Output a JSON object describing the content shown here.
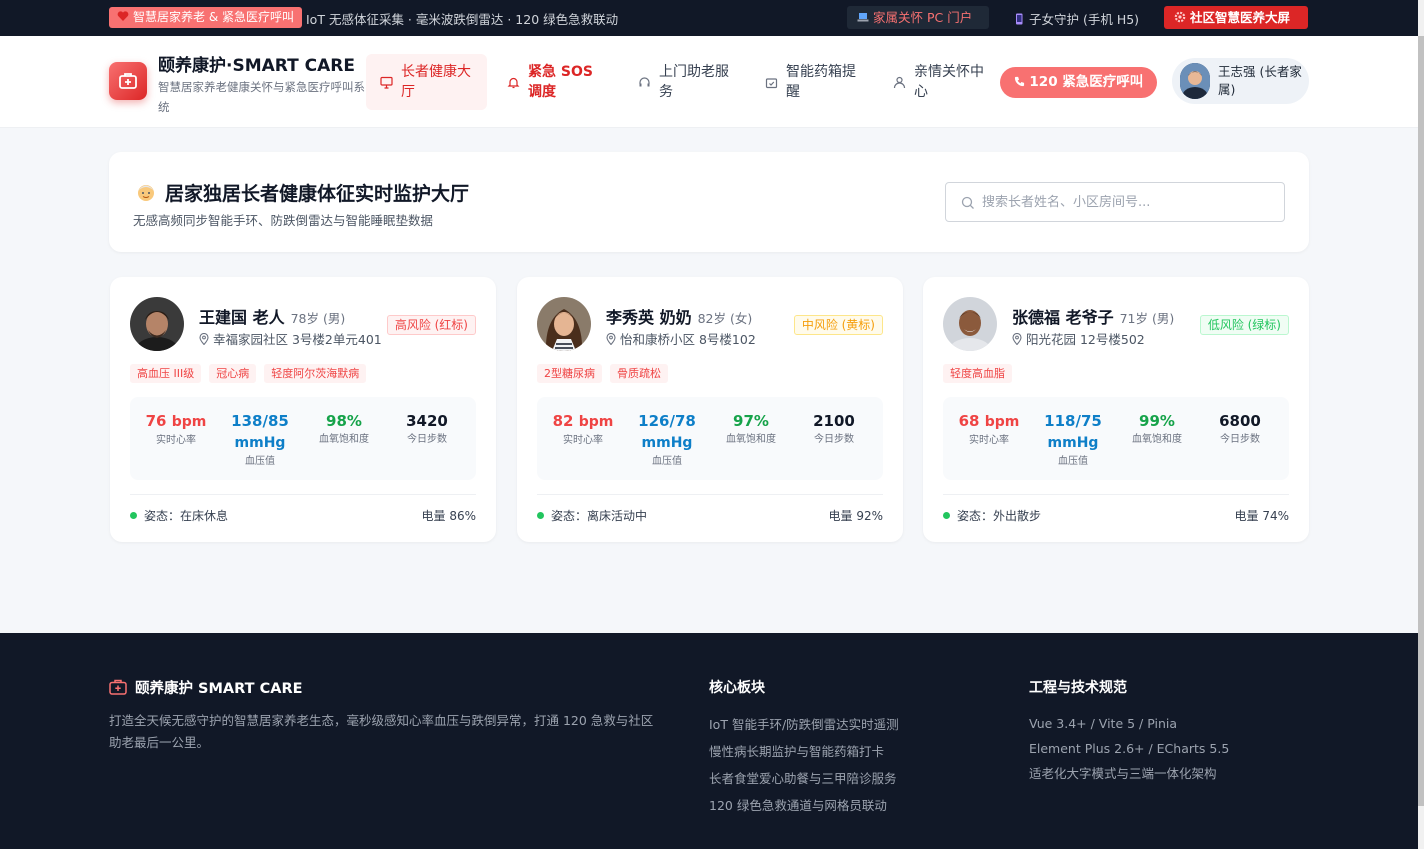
{
  "topbar": {
    "badge": "智慧居家养老 & 紧急医疗呼叫",
    "ticker": "IoT 无感体征采集 · 毫米波跌倒雷达 · 120 绿色急救联动",
    "link_family_pc": "家属关怀 PC 门户",
    "link_child_h5": "子女守护 (手机 H5)",
    "link_community": "社区智慧医养大屏"
  },
  "header": {
    "brand_title": "颐养康护·SMART CARE",
    "brand_subtitle": "智慧居家养老健康关怀与紧急医疗呼叫系统",
    "nav": [
      {
        "label": "长者健康大厅",
        "icon": "monitor-icon",
        "active": true
      },
      {
        "label": "紧急 SOS 调度",
        "icon": "bell-icon",
        "active": false
      },
      {
        "label": "上门助老服务",
        "icon": "headset-icon",
        "active": false
      },
      {
        "label": "智能药箱提醒",
        "icon": "pill-box-icon",
        "active": false
      },
      {
        "label": "亲情关怀中心",
        "icon": "user-icon",
        "active": false
      }
    ],
    "emergency_button": "120 紧急医疗呼叫",
    "user_name": "王志强 (长者家属)"
  },
  "hero": {
    "title": "居家独居长者健康体征实时监护大厅",
    "subtitle": "无感高频同步智能手环、防跌倒雷达与智能睡眠垫数据",
    "search_placeholder": "搜索长者姓名、小区房间号..."
  },
  "patients": [
    {
      "name": "王建国 老人",
      "age": "78岁 (男)",
      "address": "幸福家园社区 3号楼2单元401",
      "risk": "高风险 (红标)",
      "tags": [
        "高血压 III级",
        "冠心病",
        "轻度阿尔茨海默病"
      ],
      "heart_rate": "76",
      "heart_unit": "bpm",
      "heart_label": "实时心率",
      "bp": "138/85",
      "bp_unit": "mmHg",
      "bp_label": "血压值",
      "spo2": "98%",
      "spo2_label": "血氧饱和度",
      "steps": "3420",
      "steps_label": "今日步数",
      "posture": "姿态：在床休息",
      "battery": "电量 86%"
    },
    {
      "name": "李秀英 奶奶",
      "age": "82岁 (女)",
      "address": "怡和康桥小区 8号楼102",
      "risk": "中风险 (黄标)",
      "tags": [
        "2型糖尿病",
        "骨质疏松"
      ],
      "heart_rate": "82",
      "heart_unit": "bpm",
      "heart_label": "实时心率",
      "bp": "126/78",
      "bp_unit": "mmHg",
      "bp_label": "血压值",
      "spo2": "97%",
      "spo2_label": "血氧饱和度",
      "steps": "2100",
      "steps_label": "今日步数",
      "posture": "姿态：离床活动中",
      "battery": "电量 92%"
    },
    {
      "name": "张德福 老爷子",
      "age": "71岁 (男)",
      "address": "阳光花园 12号楼502",
      "risk": "低风险 (绿标)",
      "tags": [
        "轻度高血脂"
      ],
      "heart_rate": "68",
      "heart_unit": "bpm",
      "heart_label": "实时心率",
      "bp": "118/75",
      "bp_unit": "mmHg",
      "bp_label": "血压值",
      "spo2": "99%",
      "spo2_label": "血氧饱和度",
      "steps": "6800",
      "steps_label": "今日步数",
      "posture": "姿态：外出散步",
      "battery": "电量 74%"
    }
  ],
  "footer": {
    "brand": "颐养康护 SMART CARE",
    "description": "打造全天候无感守护的智慧居家养老生态，毫秒级感知心率血压与跌倒异常，打通 120 急救与社区助老最后一公里。",
    "col1_title": "核心板块",
    "col1_items": [
      "IoT 智能手环/防跌倒雷达实时遥测",
      "慢性病长期监护与智能药箱打卡",
      "长者食堂爱心助餐与三甲陪诊服务",
      "120 绿色急救通道与网格员联动"
    ],
    "col2_title": "工程与技术规范",
    "col2_items": [
      "Vue 3.4+ / Vite 5 / Pinia",
      "Element Plus 2.6+ / ECharts 5.5",
      "适老化大字模式与三端一体化架构"
    ]
  },
  "colors": {
    "accent_red": "#dc2626",
    "soft_red": "#f87171",
    "dark_bg": "#111827",
    "risk_high": "#ef4444",
    "risk_mid": "#f59e0b",
    "risk_low": "#22c55e"
  }
}
